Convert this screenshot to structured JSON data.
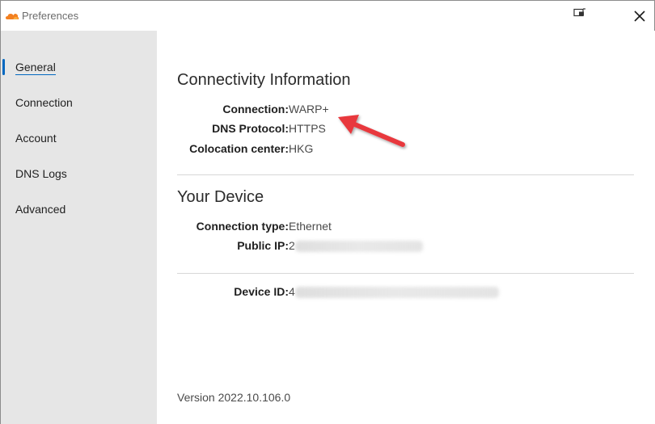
{
  "window": {
    "title": "Preferences",
    "logo_icon": "cloudflare-cloud-icon",
    "mini_icon": "compact-view-icon",
    "close_icon": "close-icon"
  },
  "sidebar": {
    "items": [
      {
        "label": "General",
        "active": true
      },
      {
        "label": "Connection",
        "active": false
      },
      {
        "label": "Account",
        "active": false
      },
      {
        "label": "DNS Logs",
        "active": false
      },
      {
        "label": "Advanced",
        "active": false
      }
    ],
    "accent_color": "#0067c0"
  },
  "connectivity": {
    "title": "Connectivity Information",
    "rows": [
      {
        "label": "Connection:",
        "value": "WARP+"
      },
      {
        "label": "DNS Protocol:",
        "value": "HTTPS"
      },
      {
        "label": "Colocation center:",
        "value": "HKG"
      }
    ]
  },
  "device": {
    "title": "Your Device",
    "rows": [
      {
        "label": "Connection type:",
        "value": "Ethernet"
      },
      {
        "label": "Public IP:",
        "value": "2",
        "blurred": true
      }
    ]
  },
  "device_id": {
    "label": "Device ID:",
    "value": "4",
    "blurred": true
  },
  "footer": {
    "version": "Version 2022.10.106.0"
  },
  "annotation": {
    "arrow_color": "#e8383d",
    "arrow_icon": "red-annotation-arrow"
  }
}
